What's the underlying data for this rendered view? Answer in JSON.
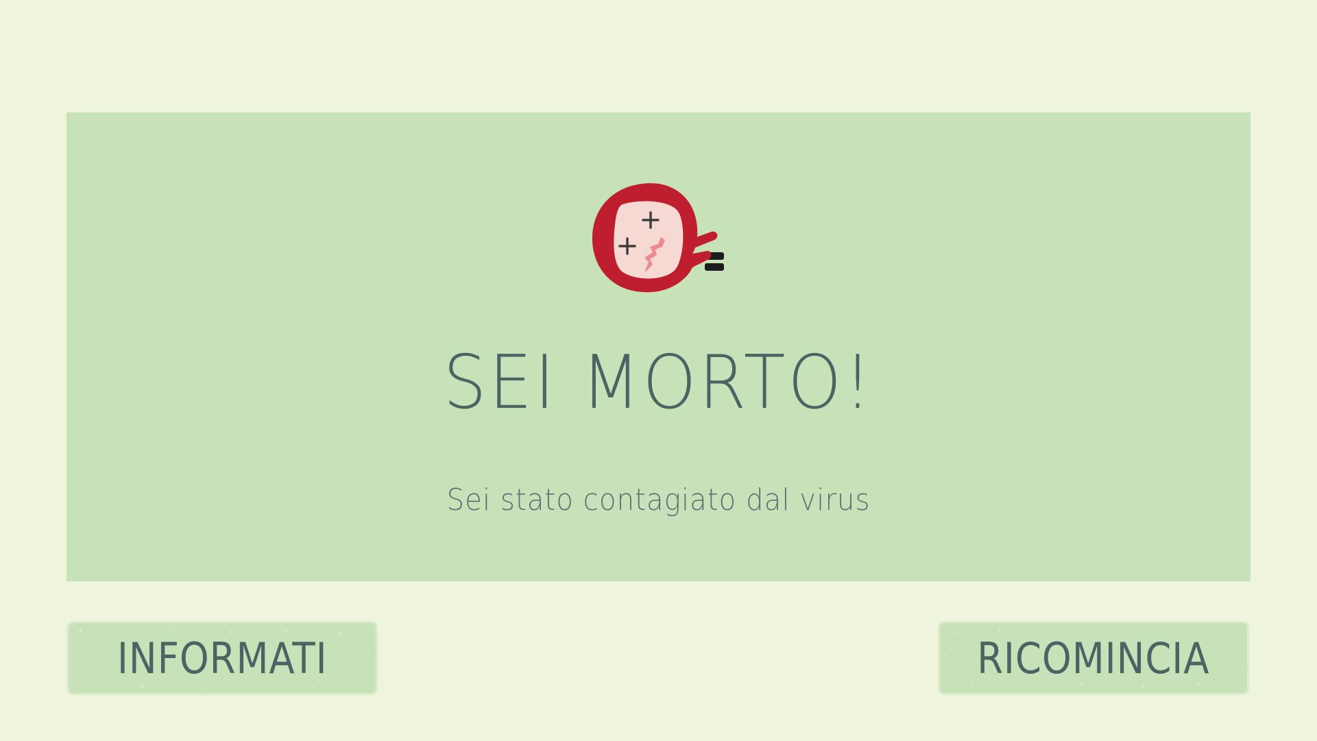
{
  "game": {
    "title": "SEI MORTO!",
    "subtitle": "Sei stato contagiato dal virus"
  },
  "buttons": {
    "info_label": "INFORMATI",
    "restart_label": "RICOMINCIA"
  },
  "colors": {
    "background": "#eef5dc",
    "panel": "#c7e2b9",
    "text": "#4a6464",
    "character_red": "#be1e2d",
    "character_face": "#f7d9d4"
  },
  "icons": {
    "character": "dead-character-icon"
  }
}
